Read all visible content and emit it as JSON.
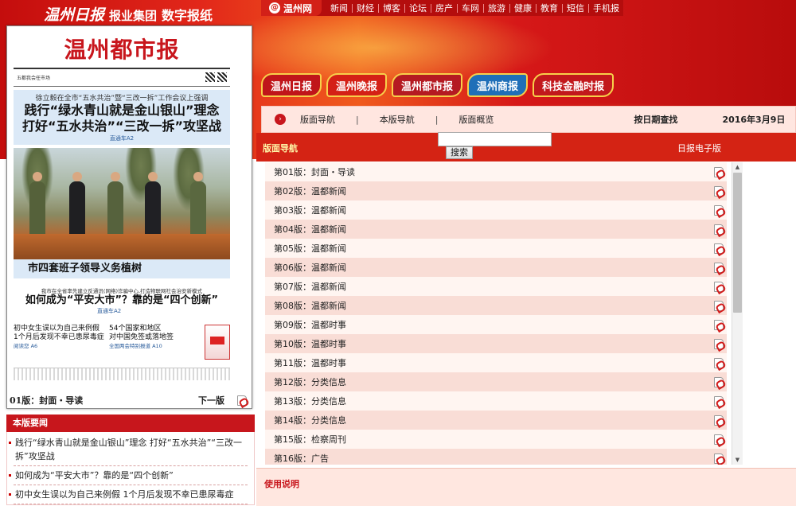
{
  "brand": {
    "logo_text": "温州日报",
    "group": "报业集团",
    "product": "数字报纸"
  },
  "topnav": {
    "site_logo": "温州网",
    "items": [
      "新闻",
      "财经",
      "博客",
      "论坛",
      "房产",
      "车网",
      "旅游",
      "健康",
      "教育",
      "短信",
      "手机报"
    ]
  },
  "paper_tabs": [
    "温州日报",
    "温州晚报",
    "温州都市报",
    "温州商报",
    "科技金融时报"
  ],
  "front_page": {
    "masthead": "温州都市报",
    "tagline": "五都我会任市场",
    "headline_pre": "徐立毅在全市“五水共治”暨“三改一拆”工作会议上强调",
    "headline_1": "践行“绿水青山就是金山银山”理念",
    "headline_2": "打好“五水共治”“三改一拆”攻坚战",
    "headline_src": "直通车A2",
    "photo_caption": "市四套班子领导义务植树",
    "sub_pre": "我市在全省率先建立反通讯(网络)诈骗中心,打造物联网社会治安新模式",
    "sub_headline": "如何成为“平安大市”？靠的是“四个创新”",
    "sub_src": "直通车A2",
    "brief1_l1": "初中女生误以为自己来例假",
    "brief1_l2": "1个月后发现不幸已患尿毒症",
    "brief1_src": "阅读您 A6",
    "brief2_l1": "54个国家和地区",
    "brief2_l2": "对中国免签或落地签",
    "brief2_src": "全国两会特别报道 A10"
  },
  "card_footer": {
    "current_page": "01版：封面・导读",
    "next": "下一版"
  },
  "highlights": {
    "title": "本版要闻",
    "items": [
      "践行“绿水青山就是金山银山”理念 打好“五水共治”“三改一拆”攻坚战",
      "如何成为“平安大市”？靠的是“四个创新”",
      "初中女生误以为自己来例假 1个月后发现不幸已患尿毒症"
    ]
  },
  "subnav": {
    "items": [
      "版面导航",
      "本版导航",
      "版面概览"
    ],
    "date_label": "按日期查找",
    "date_value": "2016年3月9日"
  },
  "section_bar": {
    "left": "版面导航",
    "right": "日报电子版"
  },
  "search": {
    "placeholder": "",
    "button": "搜索"
  },
  "pages": [
    "第01版：封面・导读",
    "第02版：温都新闻",
    "第03版：温都新闻",
    "第04版：温都新闻",
    "第05版：温都新闻",
    "第06版：温都新闻",
    "第07版：温都新闻",
    "第08版：温都新闻",
    "第09版：温都时事",
    "第10版：温都时事",
    "第11版：温都时事",
    "第12版：分类信息",
    "第13版：分类信息",
    "第14版：分类信息",
    "第15版：检察周刊",
    "第16版：广告"
  ],
  "scrollbar": {
    "position": 0
  },
  "usage": {
    "title": "使用说明"
  },
  "colors": {
    "brand_red": "#c8161d",
    "bar_red": "#d42314",
    "row_pink": "#f9ddd6",
    "row_light": "#fff5f1",
    "link_blue": "#2b5d9c"
  }
}
